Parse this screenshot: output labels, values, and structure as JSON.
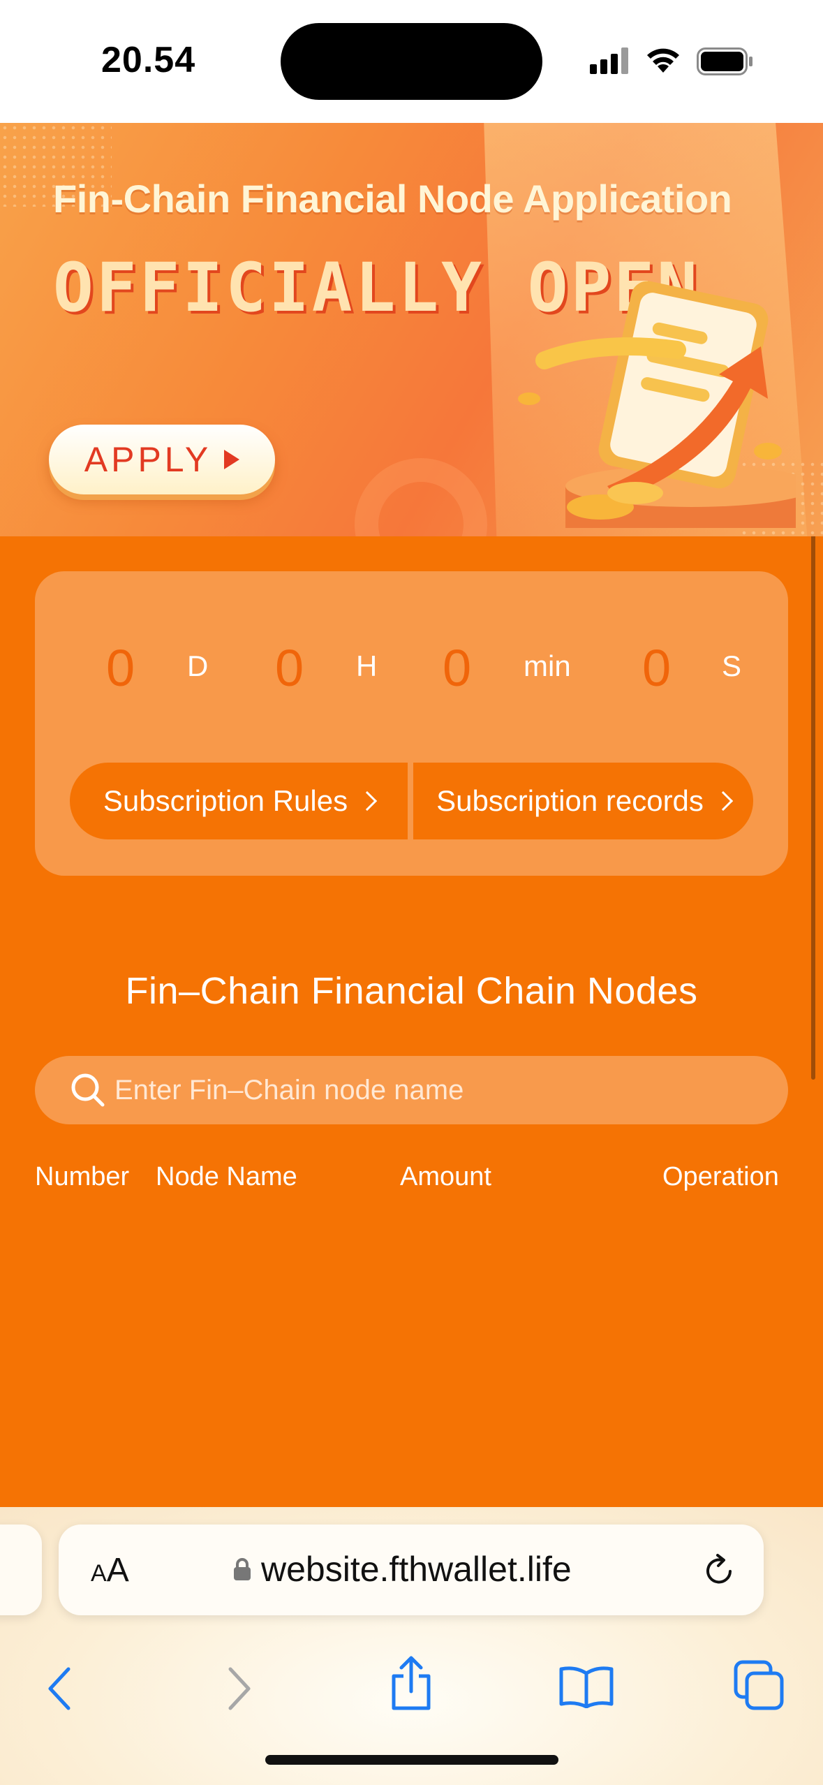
{
  "status_bar": {
    "time": "20.54"
  },
  "banner": {
    "title": "Fin-Chain Financial Node Application",
    "headline": "OFFICIALLY OPEN",
    "apply_label": "APPLY"
  },
  "countdown": {
    "days": "0",
    "days_unit": "D",
    "hours": "0",
    "hours_unit": "H",
    "minutes": "0",
    "minutes_unit": "min",
    "seconds": "0",
    "seconds_unit": "S"
  },
  "links": {
    "rules": "Subscription Rules",
    "records": "Subscription records"
  },
  "nodes": {
    "title": "Fin–Chain Financial Chain Nodes",
    "search_placeholder": "Enter Fin–Chain node name",
    "columns": [
      "Number",
      "Node Name",
      "Amount",
      "Operation"
    ]
  },
  "browser": {
    "aa_label": "AA",
    "url": "website.fthwallet.life"
  },
  "colors": {
    "page_bg": "#F57304",
    "card_bg": "#F8994A",
    "accent_number": "#F0650A",
    "safari_blue": "#1E7BF2"
  }
}
